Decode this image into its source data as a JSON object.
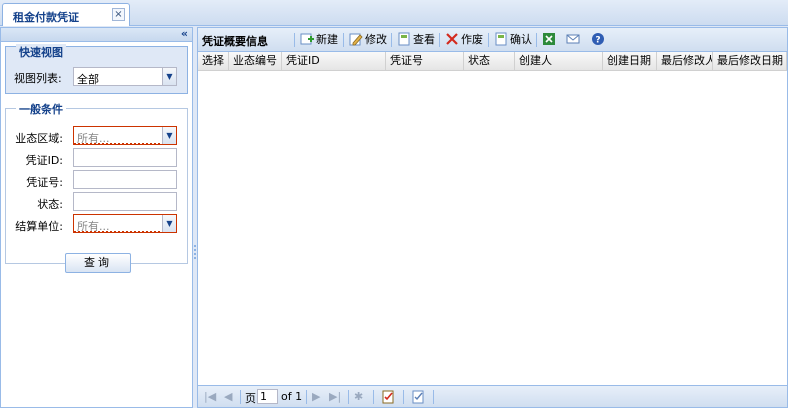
{
  "tab": {
    "title": "租金付款凭证",
    "close": "×"
  },
  "left": {
    "collapse": "«",
    "quick": {
      "legend": "快速视图",
      "view_label": "视图列表:",
      "view_value": "全部"
    },
    "general": {
      "legend": "一般条件",
      "fields": [
        {
          "label": "业态区域:",
          "type": "combo",
          "placeholder": "所有..."
        },
        {
          "label": "凭证ID:",
          "type": "text",
          "value": ""
        },
        {
          "label": "凭证号:",
          "type": "text",
          "value": ""
        },
        {
          "label": "状态:",
          "type": "text",
          "value": ""
        },
        {
          "label": "结算单位:",
          "type": "combo",
          "placeholder": "所有..."
        }
      ]
    },
    "query_button": "查询"
  },
  "grid": {
    "title": "凭证概要信息",
    "toolbar": {
      "new": "新建",
      "edit": "修改",
      "view": "查看",
      "void": "作废",
      "confirm": "确认"
    },
    "columns": [
      "选择",
      "业态编号",
      "凭证ID",
      "凭证号",
      "状态",
      "创建人",
      "创建日期",
      "最后修改人",
      "最后修改日期"
    ],
    "paging": {
      "page_label": "页",
      "page": "1",
      "of": "of 1"
    }
  },
  "colors": {
    "accent": "#15428b",
    "border": "#99bbe8",
    "panel_bg": "#dfe8f6"
  }
}
